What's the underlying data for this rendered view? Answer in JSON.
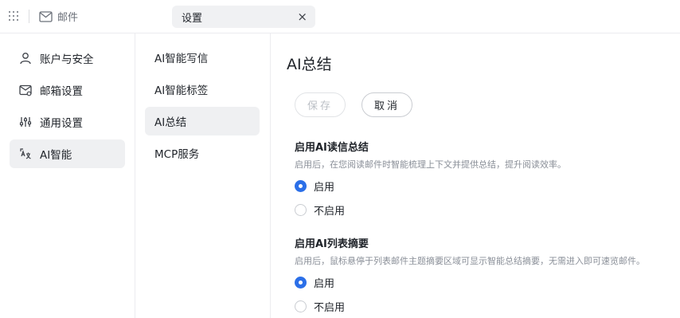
{
  "app": {
    "name": "邮件"
  },
  "tab": {
    "title": "设置",
    "close_glyph": "×"
  },
  "sidebar": {
    "items": [
      {
        "label": "账户与安全",
        "icon": "user-icon",
        "active": false
      },
      {
        "label": "邮箱设置",
        "icon": "mailbox-settings-icon",
        "active": false
      },
      {
        "label": "通用设置",
        "icon": "sliders-icon",
        "active": false
      },
      {
        "label": "AI智能",
        "icon": "ai-translate-icon",
        "active": true
      }
    ]
  },
  "subnav": {
    "items": [
      {
        "label": "AI智能写信",
        "active": false
      },
      {
        "label": "AI智能标签",
        "active": false
      },
      {
        "label": "AI总结",
        "active": true
      },
      {
        "label": "MCP服务",
        "active": false
      }
    ]
  },
  "main": {
    "title": "AI总结",
    "save_label": "保存",
    "cancel_label": "取消",
    "sections": [
      {
        "title": "启用AI读信总结",
        "description": "启用后，在您阅读邮件时智能梳理上下文并提供总结，提升阅读效率。",
        "options": [
          {
            "label": "启用",
            "checked": true
          },
          {
            "label": "不启用",
            "checked": false
          }
        ]
      },
      {
        "title": "启用AI列表摘要",
        "description": "启用后，鼠标悬停于列表邮件主题摘要区域可显示智能总结摘要，无需进入即可速览邮件。",
        "options": [
          {
            "label": "启用",
            "checked": true
          },
          {
            "label": "不启用",
            "checked": false
          }
        ]
      }
    ]
  },
  "colors": {
    "accent": "#2b6fe8",
    "active_bg": "#eff0f2"
  }
}
